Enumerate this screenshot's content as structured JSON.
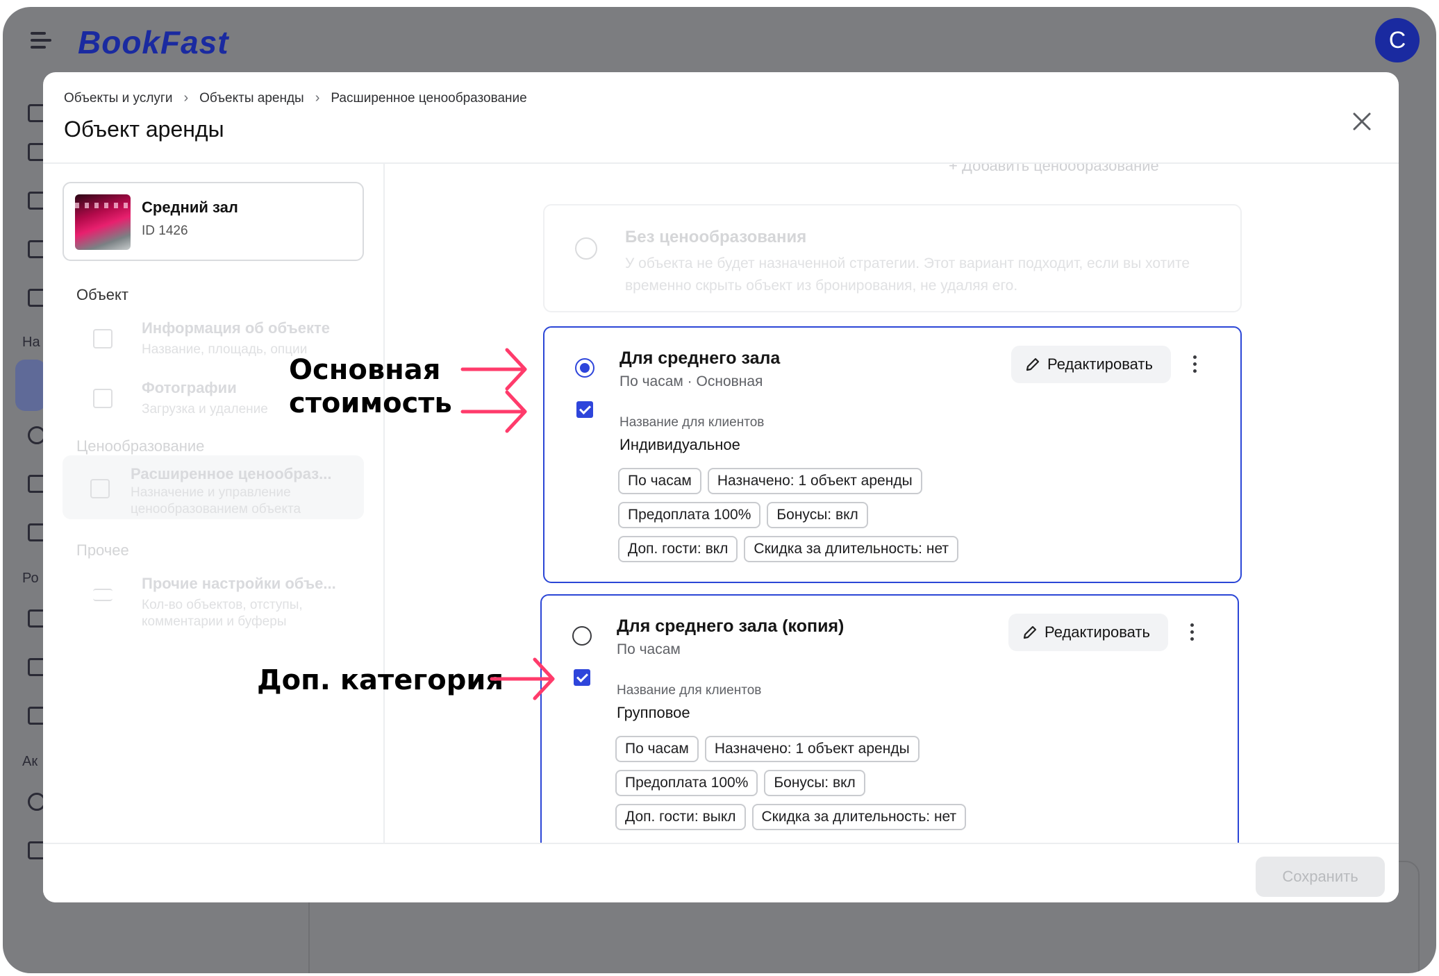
{
  "app": {
    "logo": "BookFast",
    "avatar_letter": "C"
  },
  "bg_sidebar": {
    "labels": [
      "На",
      "Ро",
      "Ак"
    ]
  },
  "modal": {
    "breadcrumbs": [
      "Объекты и услуги",
      "Объекты аренды",
      "Расширенное ценообразование"
    ],
    "title": "Объект аренды",
    "save_label": "Сохранить"
  },
  "object": {
    "name": "Средний зал",
    "id": "ID 1426"
  },
  "nav": {
    "section_object": "Объект",
    "section_pricing": "Ценообразование",
    "section_other": "Прочее",
    "items": [
      {
        "title": "Информация об объекте",
        "subtitle": "Название, площадь, опции"
      },
      {
        "title": "Фотографии",
        "subtitle": "Загрузка и удаление"
      },
      {
        "title": "Расширенное ценообраз...",
        "subtitle": "Назначение и управление ценообразованием объекта"
      },
      {
        "title": "Прочие настройки объе...",
        "subtitle": "Кол-во объектов, отступы, комментарии и буферы"
      }
    ]
  },
  "pricing": {
    "add_label": "+ Добавить ценообразование",
    "none_option": {
      "title": "Без ценообразования",
      "description": "У объекта не будет назначенной стратегии. Этот вариант подходит, если вы хотите временно скрыть объект из бронирования, не удаляя его."
    },
    "strategies": [
      {
        "title": "Для среднего зала",
        "subtitle": "По часам · Основная",
        "selected": true,
        "checked": true,
        "edit_label": "Редактировать",
        "client_label": "Название для клиентов",
        "client_name": "Индивидуальное",
        "tags": [
          [
            "По часам",
            "Назначено: 1 объект аренды"
          ],
          [
            "Предоплата 100%",
            "Бонусы: вкл"
          ],
          [
            "Доп. гости: вкл",
            "Скидка за длительность: нет"
          ]
        ]
      },
      {
        "title": "Для среднего зала (копия)",
        "subtitle": "По часам",
        "selected": false,
        "checked": true,
        "edit_label": "Редактировать",
        "client_label": "Название для клиентов",
        "client_name": "Групповое",
        "tags": [
          [
            "По часам",
            "Назначено: 1 объект аренды"
          ],
          [
            "Предоплата 100%",
            "Бонусы: вкл"
          ],
          [
            "Доп. гости: выкл",
            "Скидка за длительность: нет"
          ]
        ]
      }
    ]
  },
  "annotations": {
    "main_cost_line1": "Основная",
    "main_cost_line2": "стоимость",
    "extra_category": "Доп. категория",
    "arrow_color": "#ff3b6b"
  },
  "colors": {
    "accent": "#2e45db",
    "brand": "#1a2aa0"
  }
}
